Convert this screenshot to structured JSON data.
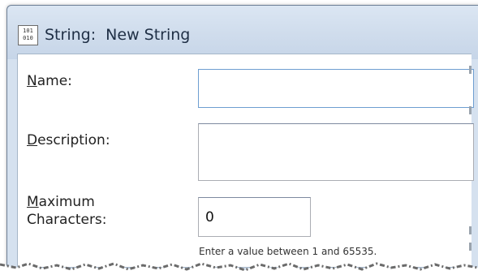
{
  "window": {
    "title": "String:  New String",
    "icon": "binary-string-icon",
    "icon_text": "101\n010"
  },
  "form": {
    "name": {
      "label_accel": "N",
      "label_rest": "ame:",
      "value": ""
    },
    "description": {
      "label_accel": "D",
      "label_rest": "escription:",
      "value": ""
    },
    "max_chars": {
      "label_accel": "M",
      "label_rest": "aximum",
      "label_line2": "Characters:",
      "value": "0",
      "hint": "Enter a value between 1 and 65535."
    }
  },
  "colors": {
    "titlebar": "#cfdcec",
    "field_focus_border": "#6e9ed1",
    "field_border": "#abadb3"
  }
}
